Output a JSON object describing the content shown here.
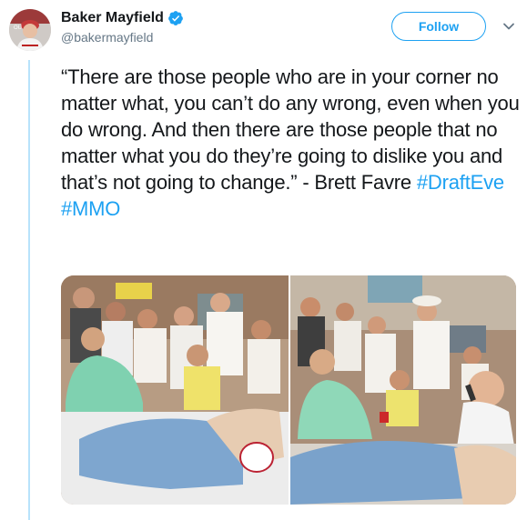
{
  "author": {
    "display_name": "Baker Mayfield",
    "handle": "@bakermayfield",
    "verified": true,
    "avatar_icon": "profile-photo"
  },
  "actions": {
    "follow_label": "Follow",
    "more_icon": "chevron-down-icon"
  },
  "tweet": {
    "text_before": "“There are those people who are in your corner no matter what, you can’t do any wrong, even when you do wrong. And then there are those people that no matter what you do they’re going to dislike you and that’s not going to change.” - Brett Favre ",
    "hashtags": [
      "#DraftEve",
      "#MMO"
    ]
  },
  "colors": {
    "accent": "#1da1f2",
    "text": "#14171a",
    "secondary_text": "#657786",
    "thread_line": "#b8e3fb"
  },
  "media": {
    "photos": [
      {
        "icon": "color-photo"
      },
      {
        "icon": "color-photo"
      }
    ]
  }
}
